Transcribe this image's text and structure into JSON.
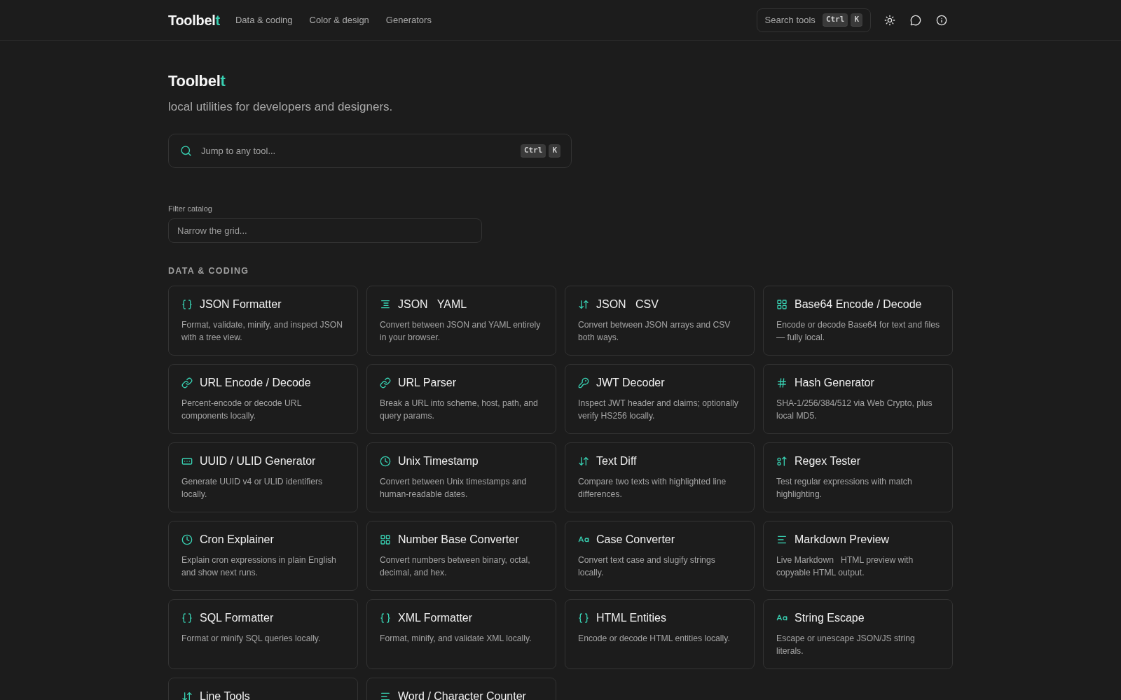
{
  "header": {
    "logo": {
      "main": "Toolbel",
      "accent": "t"
    },
    "nav": [
      "Data & coding",
      "Color & design",
      "Generators"
    ],
    "search": {
      "label": "Search tools",
      "keys": [
        "Ctrl",
        "K"
      ]
    }
  },
  "hero": {
    "title": {
      "main": "Toolbel",
      "accent": "t"
    },
    "subtitle": "local utilities for developers and designers.",
    "search": {
      "placeholder": "Jump to any tool...",
      "keys": [
        "Ctrl",
        "K"
      ]
    }
  },
  "filter": {
    "label": "Filter catalog",
    "placeholder": "Narrow the grid..."
  },
  "sections": [
    {
      "heading": "DATA & CODING",
      "tools": [
        {
          "kind": "braces",
          "title": "JSON Formatter",
          "description": "Format, validate, minify, and inspect JSON with a tree view."
        },
        {
          "kind": "indent",
          "title": "JSON   YAML",
          "description": "Convert between JSON and YAML entirely in your browser."
        },
        {
          "kind": "swap",
          "title": "JSON   CSV",
          "description": "Convert between JSON arrays and CSV both ways."
        },
        {
          "kind": "grid",
          "title": "Base64 Encode / Decode",
          "description": "Encode or decode Base64 for text and files — fully local."
        },
        {
          "kind": "link",
          "title": "URL Encode / Decode",
          "description": "Percent-encode or decode URL components locally."
        },
        {
          "kind": "link",
          "title": "URL Parser",
          "description": "Break a URL into scheme, host, path, and query params."
        },
        {
          "kind": "key",
          "title": "JWT Decoder",
          "description": "Inspect JWT header and claims; optionally verify HS256 locally."
        },
        {
          "kind": "hash",
          "title": "Hash Generator",
          "description": "SHA-1/256/384/512 via Web Crypto, plus local MD5."
        },
        {
          "kind": "dots",
          "title": "UUID / ULID Generator",
          "description": "Generate UUID v4 or ULID identifiers locally."
        },
        {
          "kind": "clock",
          "title": "Unix Timestamp",
          "description": "Convert between Unix timestamps and human-readable dates."
        },
        {
          "kind": "swap",
          "title": "Text Diff",
          "description": "Compare two texts with highlighted line differences."
        },
        {
          "kind": "regex",
          "title": "Regex Tester",
          "description": "Test regular expressions with match highlighting."
        },
        {
          "kind": "clock",
          "title": "Cron Explainer",
          "description": "Explain cron expressions in plain English and show next runs."
        },
        {
          "kind": "grid",
          "title": "Number Base Converter",
          "description": "Convert numbers between binary, octal, decimal, and hex."
        },
        {
          "kind": "case",
          "title": "Case Converter",
          "description": "Convert text case and slugify strings locally."
        },
        {
          "kind": "lines",
          "title": "Markdown Preview",
          "description": "Live Markdown   HTML preview with copyable HTML output."
        },
        {
          "kind": "braces",
          "title": "SQL Formatter",
          "description": "Format or minify SQL queries locally."
        },
        {
          "kind": "braces",
          "title": "XML Formatter",
          "description": "Format, minify, and validate XML locally."
        },
        {
          "kind": "braces",
          "title": "HTML Entities",
          "description": "Encode or decode HTML entities locally."
        },
        {
          "kind": "case",
          "title": "String Escape",
          "description": "Escape or unescape JSON/JS string literals."
        },
        {
          "kind": "swap",
          "title": "Line Tools"
        },
        {
          "kind": "lines",
          "title": "Word / Character Counter"
        }
      ]
    }
  ]
}
